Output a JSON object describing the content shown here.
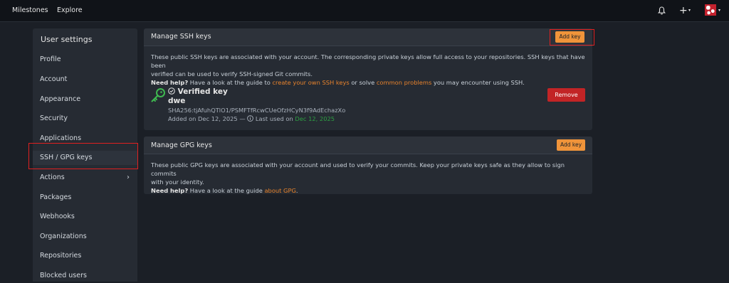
{
  "topbar": {
    "milestones": "Milestones",
    "explore": "Explore",
    "bell_icon": "bell-icon",
    "plus_icon": "+",
    "caret": "▾"
  },
  "sidebar": {
    "title": "User settings",
    "items": [
      {
        "label": "Profile"
      },
      {
        "label": "Account"
      },
      {
        "label": "Appearance"
      },
      {
        "label": "Security"
      },
      {
        "label": "Applications"
      },
      {
        "label": "SSH / GPG keys"
      },
      {
        "label": "Actions"
      },
      {
        "label": "Packages"
      },
      {
        "label": "Webhooks"
      },
      {
        "label": "Organizations"
      },
      {
        "label": "Repositories"
      },
      {
        "label": "Blocked users"
      }
    ],
    "actions_chevron": "›"
  },
  "ssh": {
    "title": "Manage SSH keys",
    "add_button": "Add key",
    "desc_1": "These public SSH keys are associated with your account. The corresponding private keys allow full access to your repositories. SSH keys that have been",
    "desc_2": "verified can be used to verify SSH-signed Git commits.",
    "help_label": "Need help?",
    "help_text_1": " Have a look at the guide to ",
    "help_link_1": "create your own SSH keys",
    "help_text_2": " or solve ",
    "help_link_2": "common problems",
    "help_text_3": " you may encounter using SSH.",
    "key": {
      "verified_label": "Verified key",
      "name": "dwe",
      "fingerprint": "SHA256:tjAfuhQTlO1/PSMFTfRcwCUeOfzHCyN3f9AdEchazXo",
      "added_prefix": "Added on Dec 12, 2025 — ",
      "last_used_prefix": " Last used on ",
      "last_used_date": "Dec 12, 2025",
      "remove_button": "Remove"
    }
  },
  "gpg": {
    "title": "Manage GPG keys",
    "add_button": "Add key",
    "desc_1": "These public GPG keys are associated with your account and used to verify your commits. Keep your private keys safe as they allow to sign commits",
    "desc_2": "with your identity.",
    "help_label": "Need help?",
    "help_text_1": " Have a look at the guide ",
    "help_link_1": "about GPG",
    "help_text_2": "."
  },
  "colors": {
    "accent": "#f0943a",
    "danger": "#c22426",
    "success": "#2ea043",
    "highlight_box": "#e02020"
  }
}
